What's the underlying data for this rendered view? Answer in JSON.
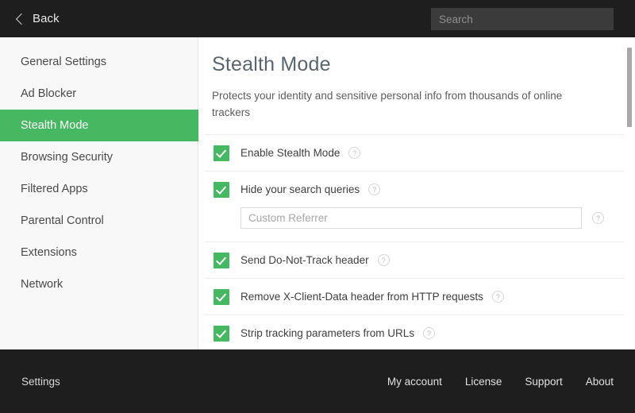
{
  "header": {
    "back_label": "Back",
    "back_icon": "chevron-left-icon",
    "search_placeholder": "Search"
  },
  "sidebar": {
    "items": [
      {
        "label": "General Settings",
        "active": false
      },
      {
        "label": "Ad Blocker",
        "active": false
      },
      {
        "label": "Stealth Mode",
        "active": true
      },
      {
        "label": "Browsing Security",
        "active": false
      },
      {
        "label": "Filtered Apps",
        "active": false
      },
      {
        "label": "Parental Control",
        "active": false
      },
      {
        "label": "Extensions",
        "active": false
      },
      {
        "label": "Network",
        "active": false
      }
    ]
  },
  "main": {
    "title": "Stealth Mode",
    "description": "Protects your identity and sensitive personal info from thousands of online trackers",
    "help_icon_glyph": "?",
    "settings": [
      {
        "label": "Enable Stealth Mode",
        "checked": true,
        "help": true
      },
      {
        "label": "Hide your search queries",
        "checked": true,
        "help": true,
        "input_placeholder": "Custom Referrer",
        "input_value": "",
        "input_help": true
      },
      {
        "label": "Send Do-Not-Track header",
        "checked": true,
        "help": true
      },
      {
        "label": "Remove X-Client-Data header from HTTP requests",
        "checked": true,
        "help": true
      },
      {
        "label": "Strip tracking parameters from URLs",
        "checked": true,
        "help": true
      }
    ]
  },
  "footer": {
    "left_label": "Settings",
    "links": [
      "My account",
      "License",
      "Support",
      "About"
    ]
  },
  "colors": {
    "accent_green": "#46b861",
    "header_dark": "#1e1e1e",
    "sidebar_bg": "#f8f8f8",
    "title_text": "#5a6570"
  }
}
